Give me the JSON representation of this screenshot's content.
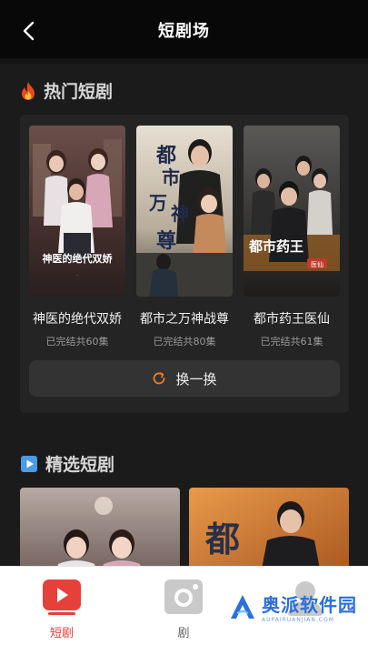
{
  "header": {
    "title": "短剧场"
  },
  "hot_section": {
    "title": "热门短剧",
    "dramas": [
      {
        "title": "神医的绝代双娇",
        "subtitle": "已完结共60集",
        "poster_text": "神医的绝代双娇"
      },
      {
        "title": "都市之万神战尊",
        "subtitle": "已完结共80集",
        "poster_text": "都市之万神战尊"
      },
      {
        "title": "都市药王医仙",
        "subtitle": "已完结共61集",
        "poster_text": "都市药王",
        "poster_badge": "医仙"
      }
    ],
    "refresh_label": "换一换"
  },
  "picks_section": {
    "title": "精选短剧"
  },
  "bottom_nav": {
    "items": [
      {
        "label": "短剧",
        "active": true
      },
      {
        "label": "剧",
        "active": false
      },
      {
        "label": "",
        "active": false
      }
    ]
  },
  "watermark": {
    "text": "奥派软件园",
    "subtext": "AUPAIRUANJIAN.COM"
  },
  "colors": {
    "accent": "#e5403a",
    "refresh_icon": "#f07a2c",
    "watermark": "#2d6fd6"
  }
}
